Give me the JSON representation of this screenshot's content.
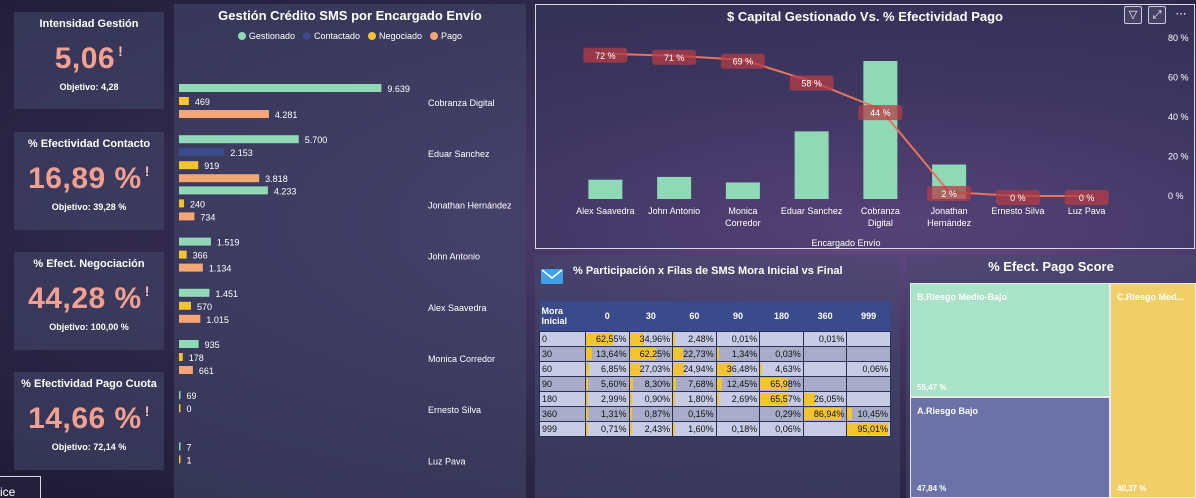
{
  "kpis": [
    {
      "title": "Intensidad Gestión",
      "value": "5,06",
      "alert": "!",
      "objective": "Objetivo: 4,28"
    },
    {
      "title": "% Efectividad Contacto",
      "value": "16,89 %",
      "alert": "!",
      "objective": "Objetivo: 39,28 %"
    },
    {
      "title": "% Efect. Negociación",
      "value": "44,28 %",
      "alert": "!",
      "objective": "Objetivo: 100,00 %"
    },
    {
      "title": "% Efectividad Pago Cuota",
      "value": "14,66 %",
      "alert": "!",
      "objective": "Objetivo: 72,14 %"
    }
  ],
  "tab": {
    "label": "ice"
  },
  "sms_chart": {
    "title": "Gestión Crédito SMS por Encargado Envío",
    "legend": [
      {
        "name": "Gestionado",
        "color": "#8fd9b6"
      },
      {
        "name": "Contactado",
        "color": "#3a4a8a"
      },
      {
        "name": "Negociado",
        "color": "#f4c430"
      },
      {
        "name": "Pago",
        "color": "#f4a675"
      }
    ]
  },
  "capital_chart": {
    "title": "$ Capital Gestionado Vs. % Efectividad Pago",
    "x_title": "Encargado Envío",
    "right_ticks": [
      "80 %",
      "60 %",
      "40 %",
      "20 %",
      "0 %"
    ],
    "filter_icon": "filter-icon",
    "focus_icon": "focus-mode-icon",
    "more_icon": "more-options-icon"
  },
  "mora_table": {
    "title": "% Participación x Filas de SMS Mora Inicial vs Final",
    "header_first": "Mora Inicial",
    "columns": [
      "0",
      "30",
      "60",
      "90",
      "180",
      "360",
      "999"
    ],
    "rows": [
      {
        "label": "0",
        "cells": [
          "62,55%",
          "34,96%",
          "2,48%",
          "0,01%",
          "",
          "0,01%",
          ""
        ],
        "fill": [
          62.55,
          34.96,
          2.48,
          0.01,
          0,
          0.01,
          0
        ]
      },
      {
        "label": "30",
        "cells": [
          "13,64%",
          "62,25%",
          "22,73%",
          "1,34%",
          "0,03%",
          "",
          ""
        ],
        "fill": [
          13.64,
          62.25,
          22.73,
          1.34,
          0.03,
          0,
          0
        ]
      },
      {
        "label": "60",
        "cells": [
          "6,85%",
          "27,03%",
          "24,94%",
          "36,48%",
          "4,63%",
          "",
          "0,06%"
        ],
        "fill": [
          6.85,
          27.03,
          24.94,
          36.48,
          4.63,
          0,
          0.06
        ]
      },
      {
        "label": "90",
        "cells": [
          "5,60%",
          "8,30%",
          "7,68%",
          "12,45%",
          "65,98%",
          "",
          ""
        ],
        "fill": [
          5.6,
          8.3,
          7.68,
          12.45,
          65.98,
          0,
          0
        ]
      },
      {
        "label": "180",
        "cells": [
          "2,99%",
          "0,90%",
          "1,80%",
          "2,69%",
          "65,57%",
          "26,05%",
          ""
        ],
        "fill": [
          2.99,
          0.9,
          1.8,
          2.69,
          65.57,
          26.05,
          0
        ]
      },
      {
        "label": "360",
        "cells": [
          "1,31%",
          "0,87%",
          "0,15%",
          "",
          "0,29%",
          "86,94%",
          "10,45%"
        ],
        "fill": [
          1.31,
          0.87,
          0.15,
          0,
          0.29,
          86.94,
          10.45
        ]
      },
      {
        "label": "999",
        "cells": [
          "0,71%",
          "2,43%",
          "1,60%",
          "0,18%",
          "0,06%",
          "",
          "95,01%"
        ],
        "fill": [
          0.71,
          2.43,
          1.6,
          0.18,
          0.06,
          0,
          95.01
        ]
      }
    ]
  },
  "score": {
    "title": "% Efect. Pago Score",
    "tiles": [
      {
        "name": "B.Riesgo Medio-Bajo",
        "value": "55,47 %",
        "color": "#a8e3c8"
      },
      {
        "name": "A.Riesgo Bajo",
        "value": "47,84 %",
        "color": "#6a72a8"
      },
      {
        "name": "C.Riesgo Med...",
        "value": "40,37 %",
        "color": "#f0cf68"
      }
    ]
  },
  "chart_data": [
    {
      "type": "bar",
      "title": "Gestión Crédito SMS por Encargado Envío",
      "orientation": "horizontal",
      "categories": [
        "Cobranza Digital",
        "Eduar Sanchez",
        "Jonathan Hernández",
        "John Antonio",
        "Alex Saavedra",
        "Monica Corredor",
        "Ernesto Silva",
        "Luz Pava"
      ],
      "series": [
        {
          "name": "Gestionado",
          "values": [
            9639,
            5700,
            4233,
            1519,
            1451,
            935,
            69,
            7
          ],
          "labels": [
            "9.639",
            "5.700",
            "4.233",
            "1.519",
            "1.451",
            "935",
            "69",
            "7"
          ]
        },
        {
          "name": "Contactado",
          "values": [
            0,
            2153,
            0,
            0,
            0,
            0,
            0,
            0
          ],
          "labels": [
            "",
            "2.153",
            "",
            "",
            "",
            "",
            "",
            ""
          ]
        },
        {
          "name": "Negociado",
          "values": [
            469,
            919,
            240,
            366,
            570,
            178,
            0,
            1
          ],
          "labels": [
            "469",
            "919",
            "240",
            "366",
            "570",
            "178",
            "0",
            "1"
          ]
        },
        {
          "name": "Pago",
          "values": [
            4281,
            3818,
            734,
            1134,
            1015,
            661,
            0,
            0
          ],
          "labels": [
            "4.281",
            "3.818",
            "734",
            "1.134",
            "1.015",
            "661",
            "",
            ""
          ]
        }
      ],
      "xlim": [
        0,
        10000
      ]
    },
    {
      "type": "bar",
      "title": "$ Capital Gestionado Vs. % Efectividad Pago",
      "xlabel": "Encargado Envío",
      "categories": [
        "Alex Saavedra",
        "John Antonio",
        "Monica Corredor",
        "Eduar Sanchez",
        "Cobranza Digital",
        "Jonathan Hernández",
        "Ernesto Silva",
        "Luz Pava"
      ],
      "category_labels": [
        [
          "Alex Saavedra"
        ],
        [
          "John Antonio"
        ],
        [
          "Monica",
          "Corredor"
        ],
        [
          "Eduar Sanchez"
        ],
        [
          "Cobranza",
          "Digital"
        ],
        [
          "Jonathan",
          "Hernández"
        ],
        [
          "Ernesto Silva"
        ],
        [
          "Luz Pava"
        ]
      ],
      "bar_values_relative": [
        0.14,
        0.16,
        0.12,
        0.49,
        1.0,
        0.25,
        0,
        0
      ],
      "line": {
        "name": "% Efectividad Pago",
        "values": [
          72,
          71,
          69,
          58,
          44,
          2,
          0,
          0
        ],
        "labels": [
          "72 %",
          "71 %",
          "69 %",
          "58 %",
          "44 %",
          "2 %",
          "0 %",
          "0 %"
        ]
      },
      "y2lim": [
        0,
        80
      ]
    }
  ]
}
